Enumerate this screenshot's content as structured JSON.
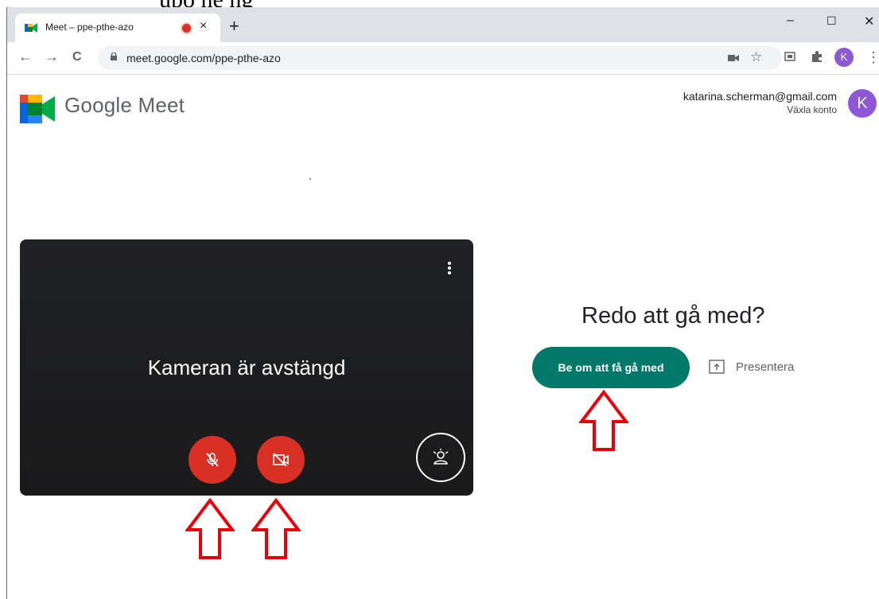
{
  "header_crop_text": "upo ne  ng",
  "browser": {
    "tab_title": "Meet – ppe-pthe-azo",
    "tab_close": "×",
    "new_tab": "+",
    "window_controls": {
      "minimize": "–",
      "maximize": "☐",
      "close": "✕"
    },
    "nav": {
      "back": "←",
      "forward": "→",
      "reload": "C"
    },
    "url": "meet.google.com/ppe-pthe-azo",
    "star": "☆",
    "profile_initial": "K",
    "menu": "⋮"
  },
  "meet": {
    "brand": "Google Meet",
    "account_email": "katarina.scherman@gmail.com",
    "switch_account": "Växla konto",
    "avatar_initial": "K",
    "camera_off_text": "Kameran är avstängd",
    "ready_heading": "Redo att gå med?",
    "join_button": "Be om att få gå med",
    "present_label": "Presentera"
  },
  "colors": {
    "join_green": "#00796b",
    "mute_red": "#d93025",
    "avatar_purple": "#8e57d6",
    "annotation_arrow_red": "#e8000b"
  }
}
